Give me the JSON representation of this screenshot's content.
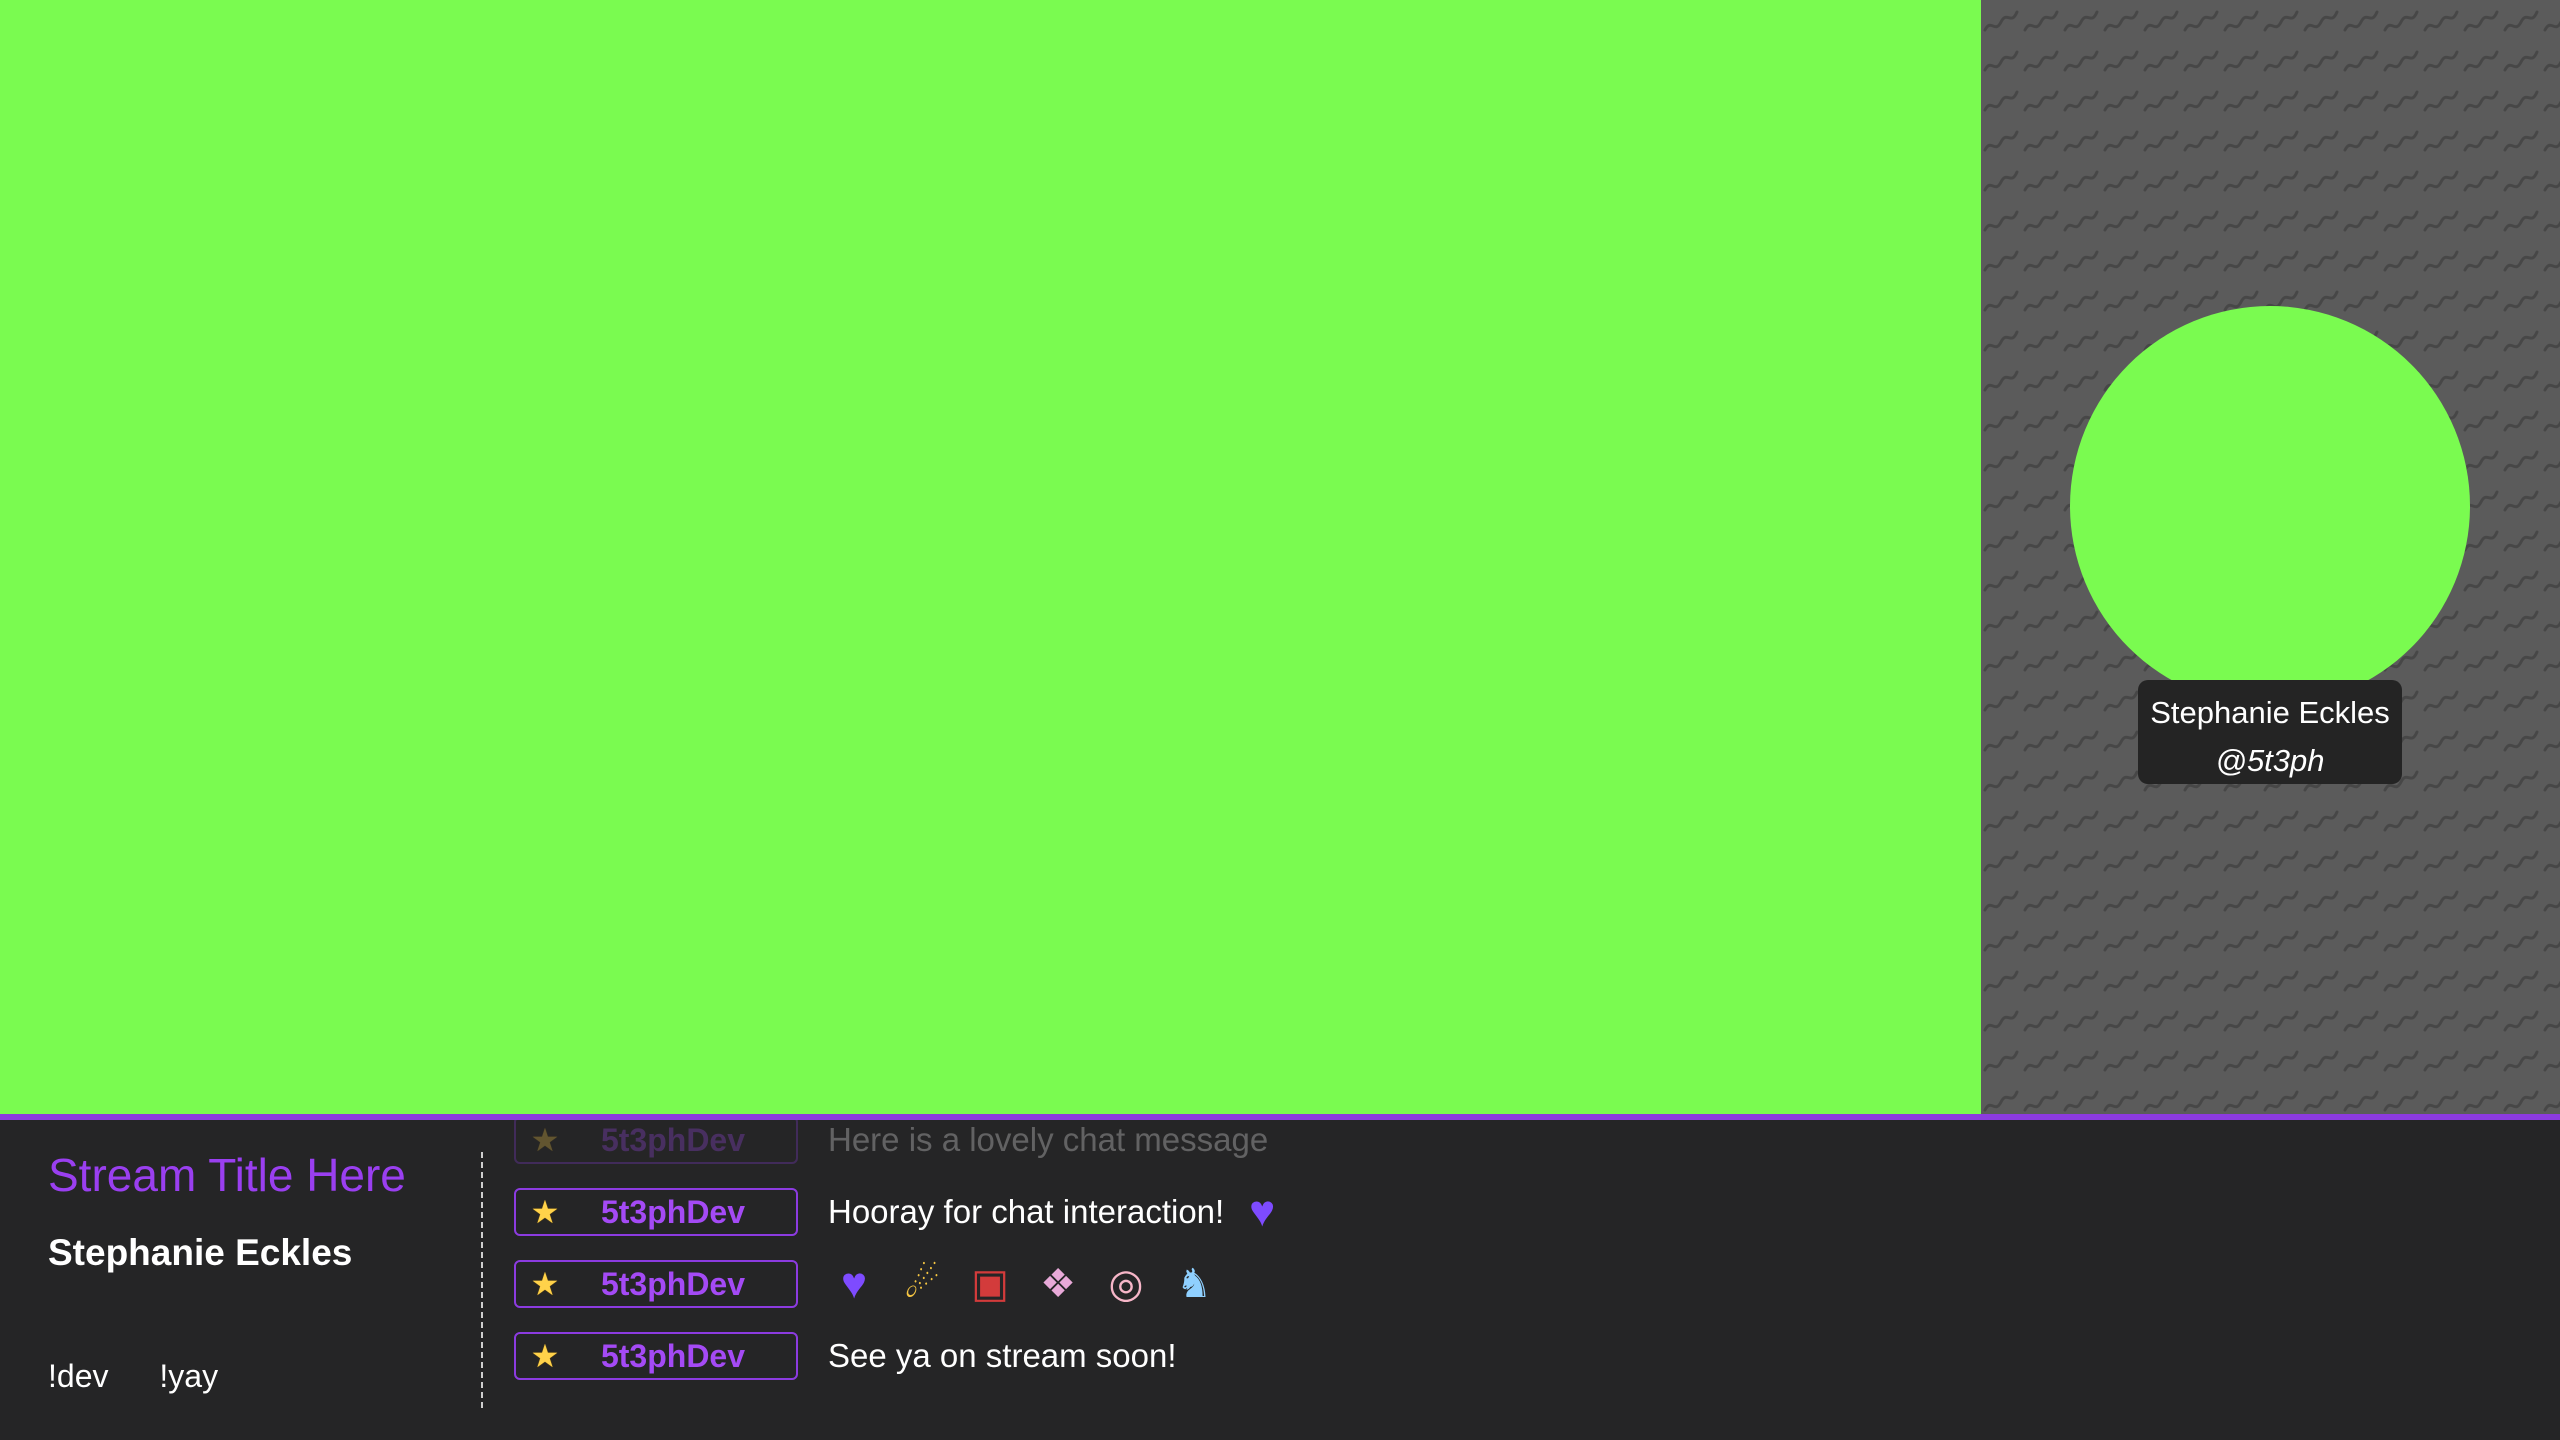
{
  "overlay": {
    "camera": {
      "name": "Stephanie Eckles",
      "handle": "@5t3ph"
    },
    "colors": {
      "green_screen": "#7afb50",
      "accent": "#8c3be0",
      "panel_bg": "#252526"
    }
  },
  "info": {
    "title": "Stream Title Here",
    "streamer": "Stephanie Eckles",
    "commands": [
      "!dev",
      "!yay"
    ]
  },
  "chat": {
    "messages": [
      {
        "badge_icon": "star-icon",
        "user": "5t3phDev",
        "text": "Here is a lovely chat message",
        "faded": true
      },
      {
        "badge_icon": "star-icon",
        "user": "5t3phDev",
        "text": "Hooray for chat interaction!",
        "emotes": [
          "purple-heart-emote"
        ]
      },
      {
        "badge_icon": "star-icon",
        "user": "5t3phDev",
        "text": "",
        "emotes": [
          "purple-heart-emote",
          "shooting-star-emote",
          "popcorn-emote",
          "chocolate-box-emote",
          "donut-emote",
          "unicorn-emote"
        ]
      },
      {
        "badge_icon": "star-icon",
        "user": "5t3phDev",
        "text": "See ya on stream soon!"
      }
    ]
  }
}
